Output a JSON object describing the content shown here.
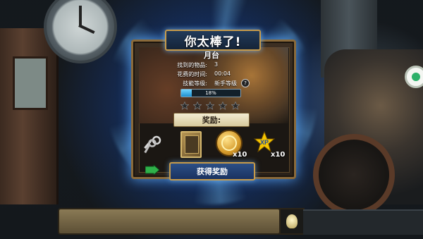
{
  "dialog": {
    "title": "你太棒了!",
    "scene_name": "月台",
    "stats": [
      {
        "label": "找到的物品:",
        "value": "3"
      },
      {
        "label": "花费的时间:",
        "value": "00:04"
      },
      {
        "label": "技能等级:",
        "value": "新手等级"
      }
    ],
    "help_glyph": "?",
    "progress": {
      "percent": 18,
      "label": "18%"
    },
    "stars": {
      "total": 5,
      "filled": 0
    },
    "rewards_header": "奖励:",
    "rewards": [
      {
        "name": "keys",
        "quantity": ""
      },
      {
        "name": "book",
        "quantity": ""
      },
      {
        "name": "coins",
        "quantity": "x10"
      },
      {
        "name": "xp",
        "quantity": "x10"
      }
    ],
    "collect_button": "获得奖励"
  },
  "colors": {
    "glow": "#6fd3ff",
    "gold_border": "#c69a4a",
    "button_blue": "#2b4f86"
  }
}
